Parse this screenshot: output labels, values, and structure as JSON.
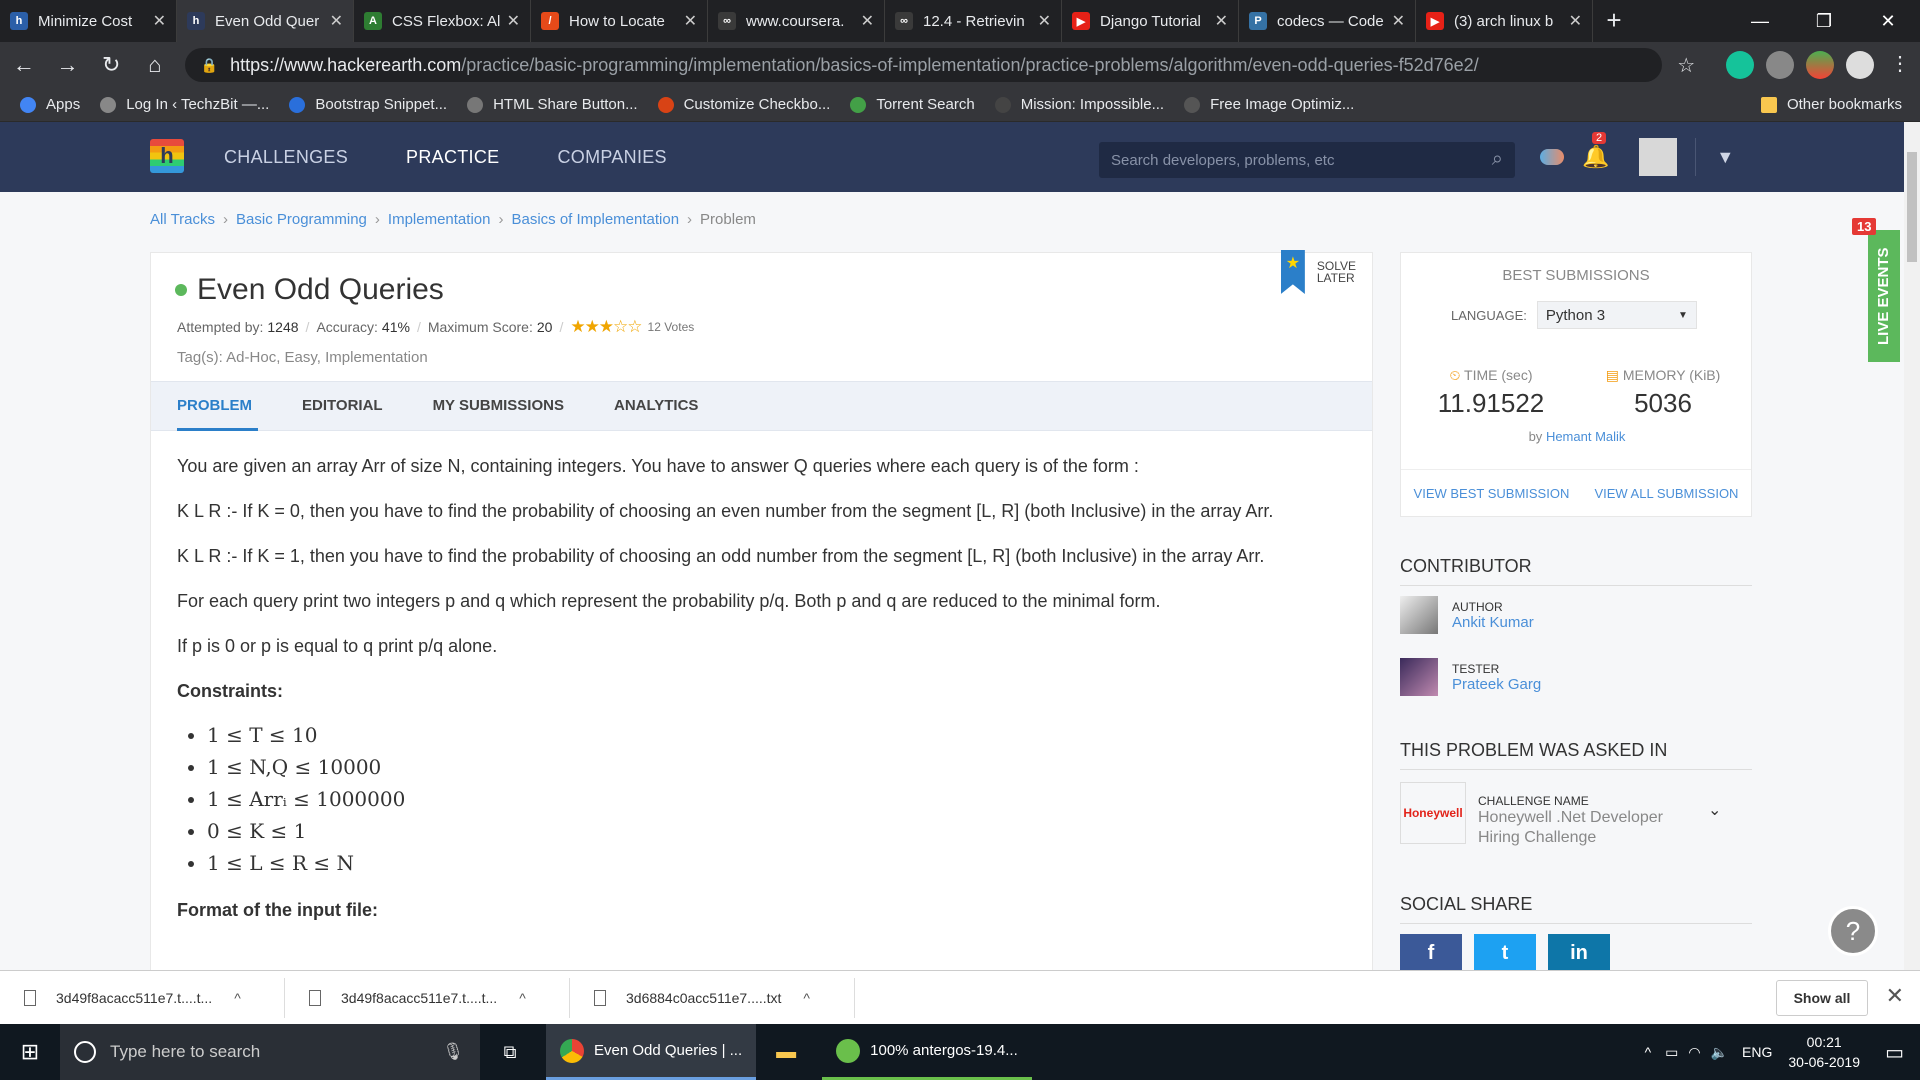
{
  "browser": {
    "tabs": [
      {
        "title": "Minimize Cost",
        "color": "#2b5fa8",
        "glyph": "h"
      },
      {
        "title": "Even Odd Quer",
        "color": "#2d3a5a",
        "glyph": "h"
      },
      {
        "title": "CSS Flexbox: Al",
        "color": "#2e7d32",
        "glyph": "A"
      },
      {
        "title": "How to Locate",
        "color": "#e64a19",
        "glyph": "/"
      },
      {
        "title": "www.coursera.",
        "color": "#3a3a3a",
        "glyph": "∞"
      },
      {
        "title": "12.4 - Retrievin",
        "color": "#3a3a3a",
        "glyph": "∞"
      },
      {
        "title": "Django Tutorial",
        "color": "#e62117",
        "glyph": "▶"
      },
      {
        "title": "codecs — Code",
        "color": "#3572a5",
        "glyph": "P"
      },
      {
        "title": "(3) arch linux b",
        "color": "#e62117",
        "glyph": "▶"
      }
    ],
    "url_host": "https://www.hackerearth.com",
    "url_path": "/practice/basic-programming/implementation/basics-of-implementation/practice-problems/algorithm/even-odd-queries-f52d76e2/",
    "bookmarks": [
      {
        "label": "Apps",
        "color": "#4285f4"
      },
      {
        "label": "Log In ‹ TechzBit —...",
        "color": "#888"
      },
      {
        "label": "Bootstrap Snippet...",
        "color": "#2a6fdb"
      },
      {
        "label": "HTML Share Button...",
        "color": "#777"
      },
      {
        "label": "Customize Checkbo...",
        "color": "#d84315"
      },
      {
        "label": "Torrent Search",
        "color": "#43a047"
      },
      {
        "label": "Mission: Impossible...",
        "color": "#444"
      },
      {
        "label": "Free Image Optimiz...",
        "color": "#555"
      }
    ],
    "other_bookmarks": "Other bookmarks"
  },
  "site": {
    "nav": [
      "CHALLENGES",
      "PRACTICE",
      "COMPANIES"
    ],
    "search_placeholder": "Search developers, problems, etc",
    "notif_count": "2"
  },
  "breadcrumb": [
    "All Tracks",
    "Basic Programming",
    "Implementation",
    "Basics of Implementation",
    "Problem"
  ],
  "problem": {
    "title": "Even Odd Queries",
    "attempted_label": "Attempted by:",
    "attempted": "1248",
    "accuracy_label": "Accuracy:",
    "accuracy": "41%",
    "score_label": "Maximum Score:",
    "score": "20",
    "rating": 3,
    "votes": "12 Votes",
    "tags": "Tag(s): Ad-Hoc, Easy, Implementation",
    "solve_later": "SOLVE LATER",
    "tabs": [
      "PROBLEM",
      "EDITORIAL",
      "MY SUBMISSIONS",
      "ANALYTICS"
    ],
    "p1": "You are given an array Arr of size N, containing integers. You have to answer Q queries where each query is of the form :",
    "p2": "K L R :- If K = 0, then you have to find the probability of choosing an even number from the segment [L, R] (both Inclusive) in the array Arr.",
    "p3": "K L R :- If K = 1, then you have to find the probability of choosing an odd number from the segment [L, R] (both Inclusive) in the array Arr.",
    "p4": "For each query print two integers p and q which represent the probability p/q. Both p and q are reduced to the minimal form.",
    "p5": "If p is 0 or p is equal to q print p/q alone.",
    "constraints_title": "Constraints:",
    "constraints": [
      "1 ≤ T ≤ 10",
      "1 ≤ N,Q ≤ 10000",
      "1 ≤ Arrᵢ ≤ 1000000",
      "0 ≤ K ≤ 1",
      "1 ≤ L ≤ R ≤ N"
    ],
    "format_title": "Format of the input file:"
  },
  "best": {
    "title": "BEST SUBMISSIONS",
    "lang_label": "LANGUAGE:",
    "lang": "Python 3",
    "time_label": "TIME (sec)",
    "time": "11.91522",
    "mem_label": "MEMORY (KiB)",
    "mem": "5036",
    "by": "by",
    "by_name": "Hemant Malik",
    "view_best": "VIEW BEST SUBMISSION",
    "view_all": "VIEW ALL SUBMISSION"
  },
  "contributor": {
    "title": "CONTRIBUTOR",
    "author_label": "AUTHOR",
    "author": "Ankit Kumar",
    "tester_label": "TESTER",
    "tester": "Prateek Garg"
  },
  "asked": {
    "title": "THIS PROBLEM WAS ASKED IN",
    "logo": "Honeywell",
    "label": "CHALLENGE NAME",
    "name": "Honeywell .Net Developer Hiring Challenge"
  },
  "social": {
    "title": "SOCIAL SHARE",
    "buttons": [
      "f",
      "t",
      "in"
    ]
  },
  "live": {
    "label": "LIVE EVENTS",
    "count": "13"
  },
  "downloads": {
    "files": [
      "3d49f8acacc511e7.t....t...",
      "3d49f8acacc511e7.t....t...",
      "3d6884c0acc511e7.....txt"
    ],
    "show_all": "Show all"
  },
  "taskbar": {
    "search": "Type here to search",
    "apps": [
      "Even Odd Queries | ...",
      "100% antergos-19.4..."
    ],
    "lang": "ENG",
    "time": "00:21",
    "date": "30-06-2019"
  }
}
